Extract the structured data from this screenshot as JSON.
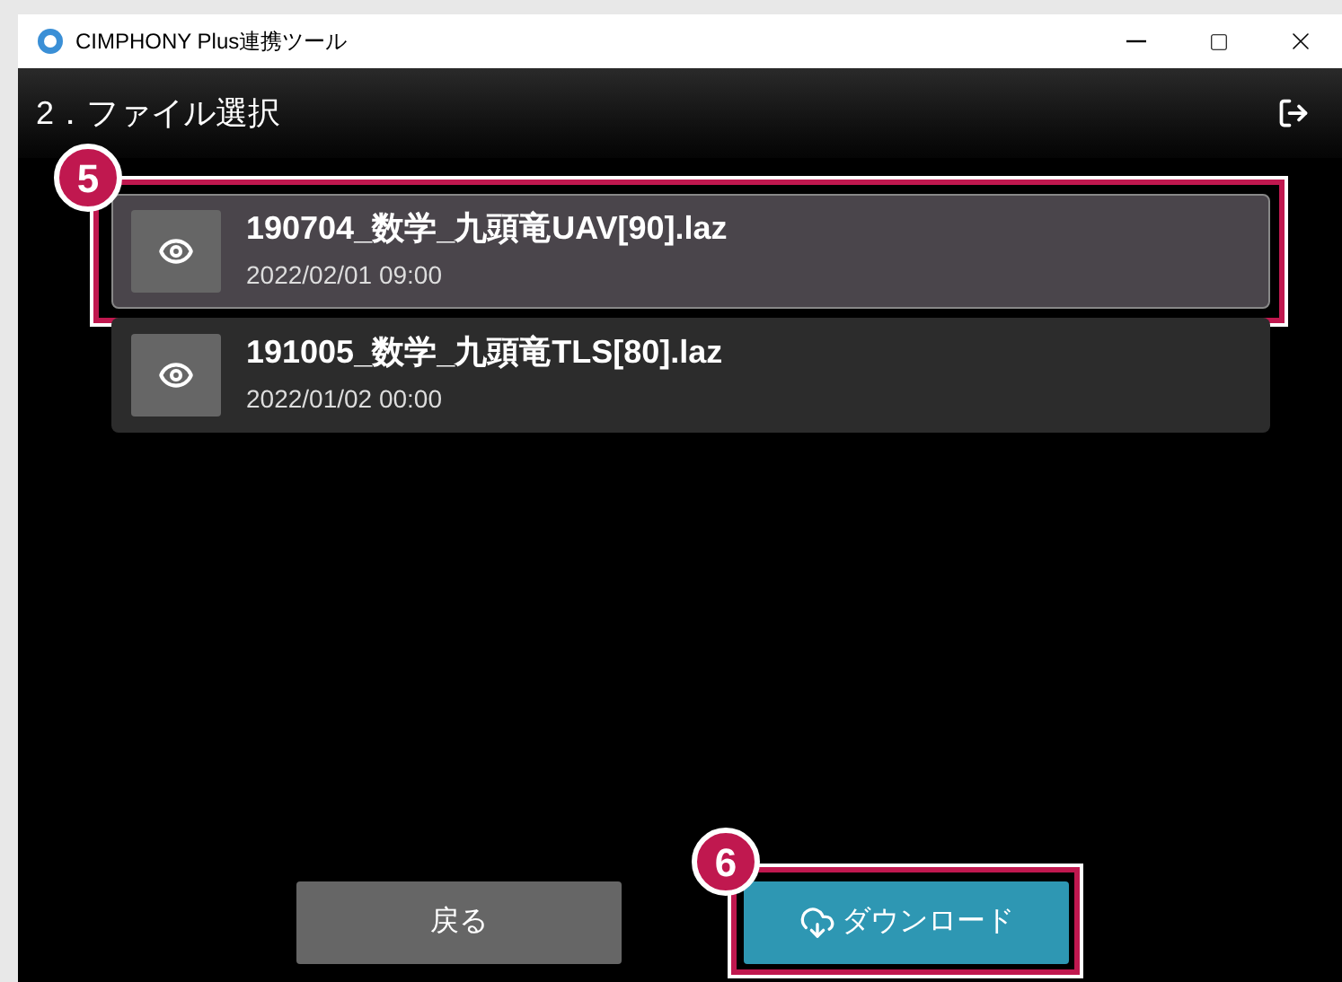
{
  "window": {
    "title": "CIMPHONY Plus連携ツール"
  },
  "header": {
    "title": "2．ファイル選択"
  },
  "files": [
    {
      "name": "190704_数学_九頭竜UAV[90].laz",
      "date": "2022/02/01 09:00",
      "selected": true,
      "callout": "5"
    },
    {
      "name": "191005_数学_九頭竜TLS[80].laz",
      "date": "2022/01/02 00:00",
      "selected": false
    }
  ],
  "buttons": [
    {
      "kind": "back",
      "label": "戻る"
    },
    {
      "kind": "download",
      "label": "ダウンロード",
      "callout": "6"
    }
  ]
}
